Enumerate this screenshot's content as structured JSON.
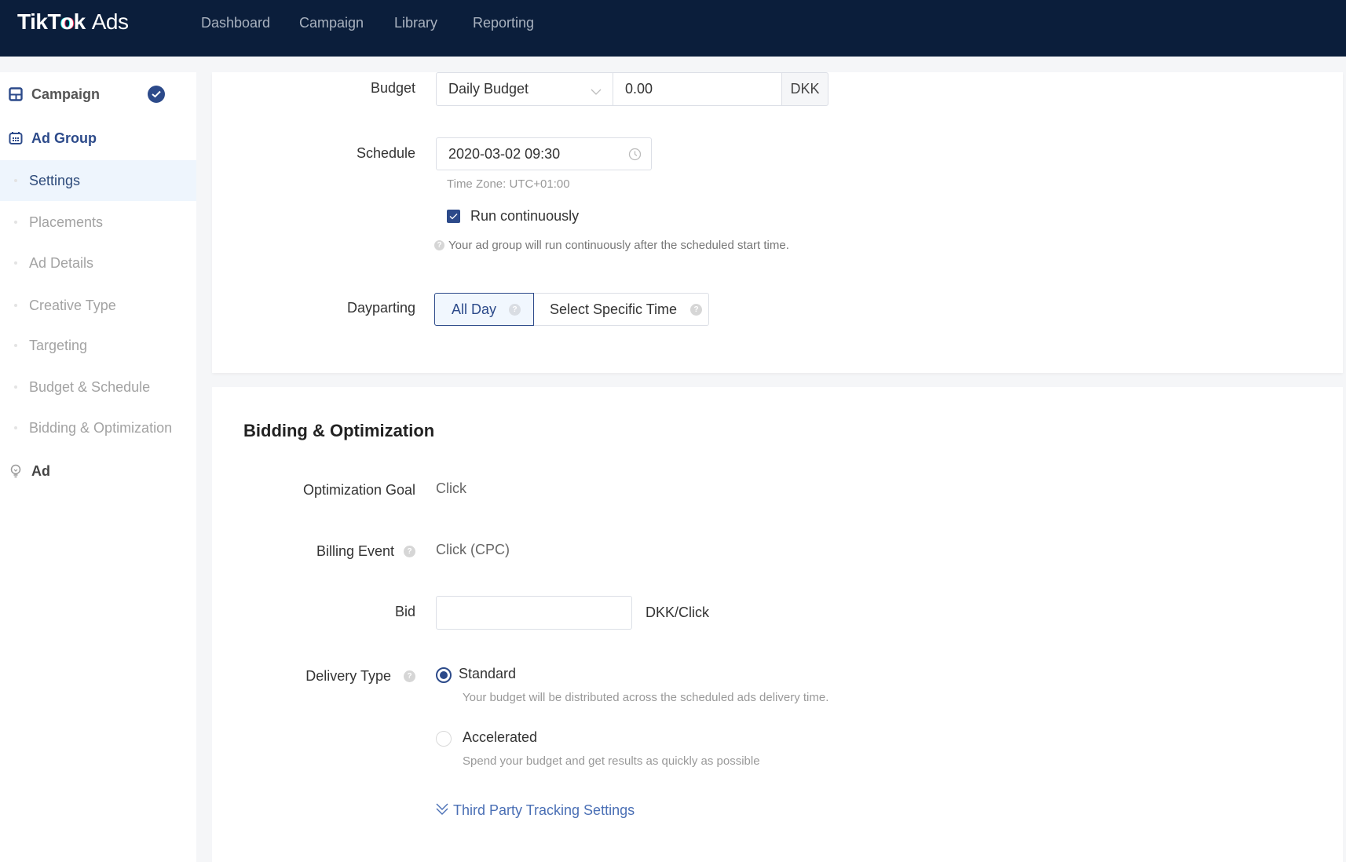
{
  "header": {
    "logo": {
      "brand": "TikTok",
      "brand_part1": "TikT",
      "brand_o": "o",
      "brand_part2": "k",
      "suffix": "Ads"
    },
    "nav": [
      "Dashboard",
      "Campaign",
      "Library",
      "Reporting"
    ]
  },
  "sidebar": {
    "campaign": {
      "label": "Campaign",
      "icon": "layout-icon",
      "status": "completed"
    },
    "ad_group": {
      "label": "Ad Group",
      "icon": "calendar-icon"
    },
    "sub_items": [
      {
        "label": "Settings",
        "active": true
      },
      {
        "label": "Placements"
      },
      {
        "label": "Ad Details"
      },
      {
        "label": "Creative Type"
      },
      {
        "label": "Targeting"
      },
      {
        "label": "Budget & Schedule"
      },
      {
        "label": "Bidding & Optimization"
      }
    ],
    "ad": {
      "label": "Ad",
      "icon": "lightbulb-icon"
    }
  },
  "budget_schedule": {
    "budget": {
      "label": "Budget",
      "type_value": "Daily Budget",
      "amount_value": "0.00",
      "currency": "DKK"
    },
    "schedule": {
      "label": "Schedule",
      "start_value": "2020-03-02 09:30",
      "time_zone": "Time Zone: UTC+01:00"
    },
    "run_continuously": {
      "label": "Run continuously",
      "checked": true,
      "help": "Your ad group will run continuously after the scheduled start time."
    },
    "dayparting": {
      "label": "Dayparting",
      "options": [
        "All Day",
        "Select Specific Time"
      ],
      "selected": "All Day"
    }
  },
  "bidding": {
    "title": "Bidding & Optimization",
    "optimization_goal": {
      "label": "Optimization Goal",
      "value": "Click"
    },
    "billing_event": {
      "label": "Billing Event",
      "value": "Click (CPC)"
    },
    "bid": {
      "label": "Bid",
      "value": "",
      "unit": "DKK/Click"
    },
    "delivery_type": {
      "label": "Delivery Type",
      "selected": "Standard",
      "options": [
        {
          "label": "Standard",
          "description": "Your budget will be distributed across the scheduled ads delivery time."
        },
        {
          "label": "Accelerated",
          "description": "Spend your budget and get results as quickly as possible"
        }
      ]
    },
    "third_party_link": "Third Party Tracking Settings"
  },
  "colors": {
    "header_bg": "#0b1e3b",
    "accent": "#2c4a8a",
    "active_bg": "#eef5fd",
    "link": "#4a6fb5"
  }
}
